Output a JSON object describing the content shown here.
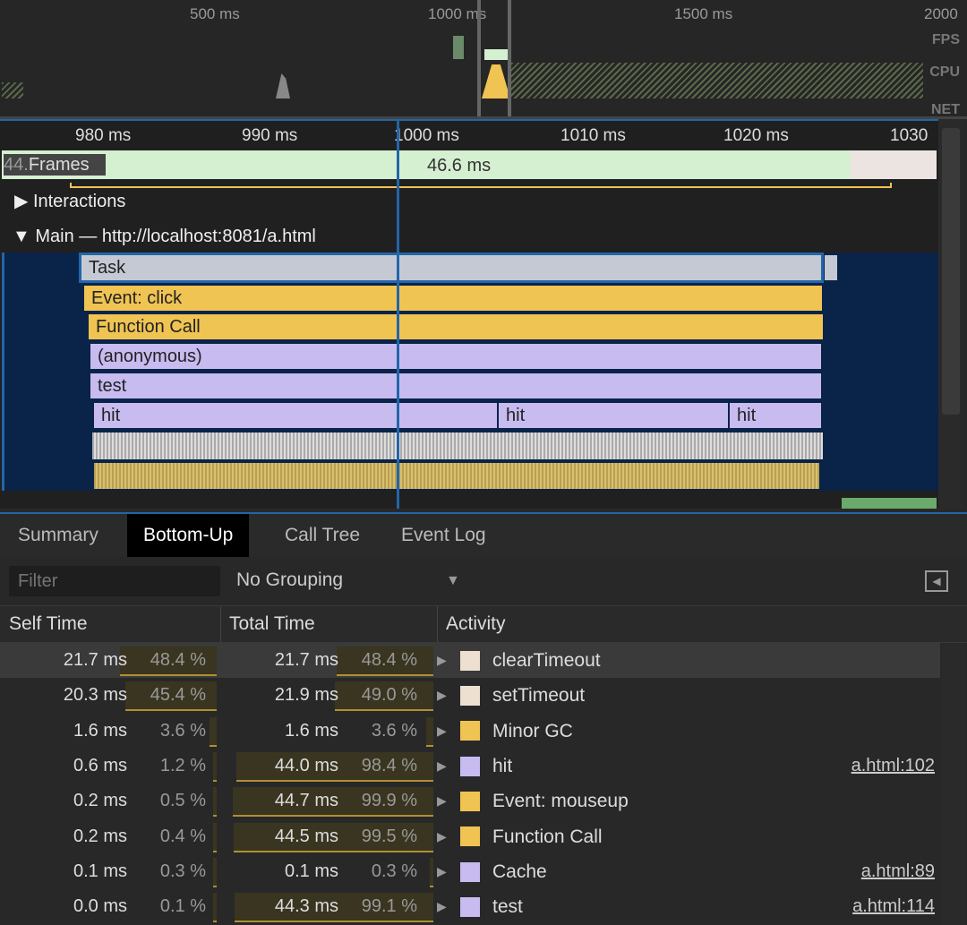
{
  "overview": {
    "ticks": [
      "500 ms",
      "1000 ms",
      "1500 ms",
      "2000"
    ],
    "labels": [
      "FPS",
      "CPU",
      "NET"
    ]
  },
  "ruler": {
    "ticks": [
      "980 ms",
      "990 ms",
      "1000 ms",
      "1010 ms",
      "1020 ms",
      "1030"
    ]
  },
  "tracks": {
    "frames_label": "Frames",
    "frame_prefix": "44.",
    "frame_duration": "46.6 ms",
    "interactions": "Interactions",
    "main": "Main — http://localhost:8081/a.html"
  },
  "flame": {
    "task": "Task",
    "event": "Event: click",
    "function_call": "Function Call",
    "anonymous": "(anonymous)",
    "test": "test",
    "hit": [
      "hit",
      "hit",
      "hit"
    ]
  },
  "colors": {
    "task": "#c5c9d3",
    "scripting": "#f0c453",
    "js": "#c8bbf0",
    "frame": "#d4f0d0",
    "bg": "#0a2348",
    "accent": "#2266aa"
  },
  "tabs": [
    {
      "label": "Summary"
    },
    {
      "label": "Bottom-Up",
      "active": true
    },
    {
      "label": "Call Tree"
    },
    {
      "label": "Event Log"
    }
  ],
  "toolbar": {
    "filter_placeholder": "Filter",
    "grouping": "No Grouping"
  },
  "table": {
    "headers": [
      "Self Time",
      "Total Time",
      "Activity"
    ],
    "rows": [
      {
        "self": "21.7 ms",
        "self_pct": "48.4 %",
        "total": "21.7 ms",
        "total_pct": "48.4 %",
        "activity": "clearTimeout",
        "color": "#eee0d0",
        "link": ""
      },
      {
        "self": "20.3 ms",
        "self_pct": "45.4 %",
        "total": "21.9 ms",
        "total_pct": "49.0 %",
        "activity": "setTimeout",
        "color": "#eee0d0",
        "link": ""
      },
      {
        "self": "1.6 ms",
        "self_pct": "3.6 %",
        "total": "1.6 ms",
        "total_pct": "3.6 %",
        "activity": "Minor GC",
        "color": "#f0c453",
        "link": ""
      },
      {
        "self": "0.6 ms",
        "self_pct": "1.2 %",
        "total": "44.0 ms",
        "total_pct": "98.4 %",
        "activity": "hit",
        "color": "#c8bbf0",
        "link": "a.html:102"
      },
      {
        "self": "0.2 ms",
        "self_pct": "0.5 %",
        "total": "44.7 ms",
        "total_pct": "99.9 %",
        "activity": "Event: mouseup",
        "color": "#f0c453",
        "link": ""
      },
      {
        "self": "0.2 ms",
        "self_pct": "0.4 %",
        "total": "44.5 ms",
        "total_pct": "99.5 %",
        "activity": "Function Call",
        "color": "#f0c453",
        "link": ""
      },
      {
        "self": "0.1 ms",
        "self_pct": "0.3 %",
        "total": "0.1 ms",
        "total_pct": "0.3 %",
        "activity": "Cache",
        "color": "#c8bbf0",
        "link": "a.html:89"
      },
      {
        "self": "0.0 ms",
        "self_pct": "0.1 %",
        "total": "44.3 ms",
        "total_pct": "99.1 %",
        "activity": "test",
        "color": "#c8bbf0",
        "link": "a.html:114"
      }
    ]
  }
}
